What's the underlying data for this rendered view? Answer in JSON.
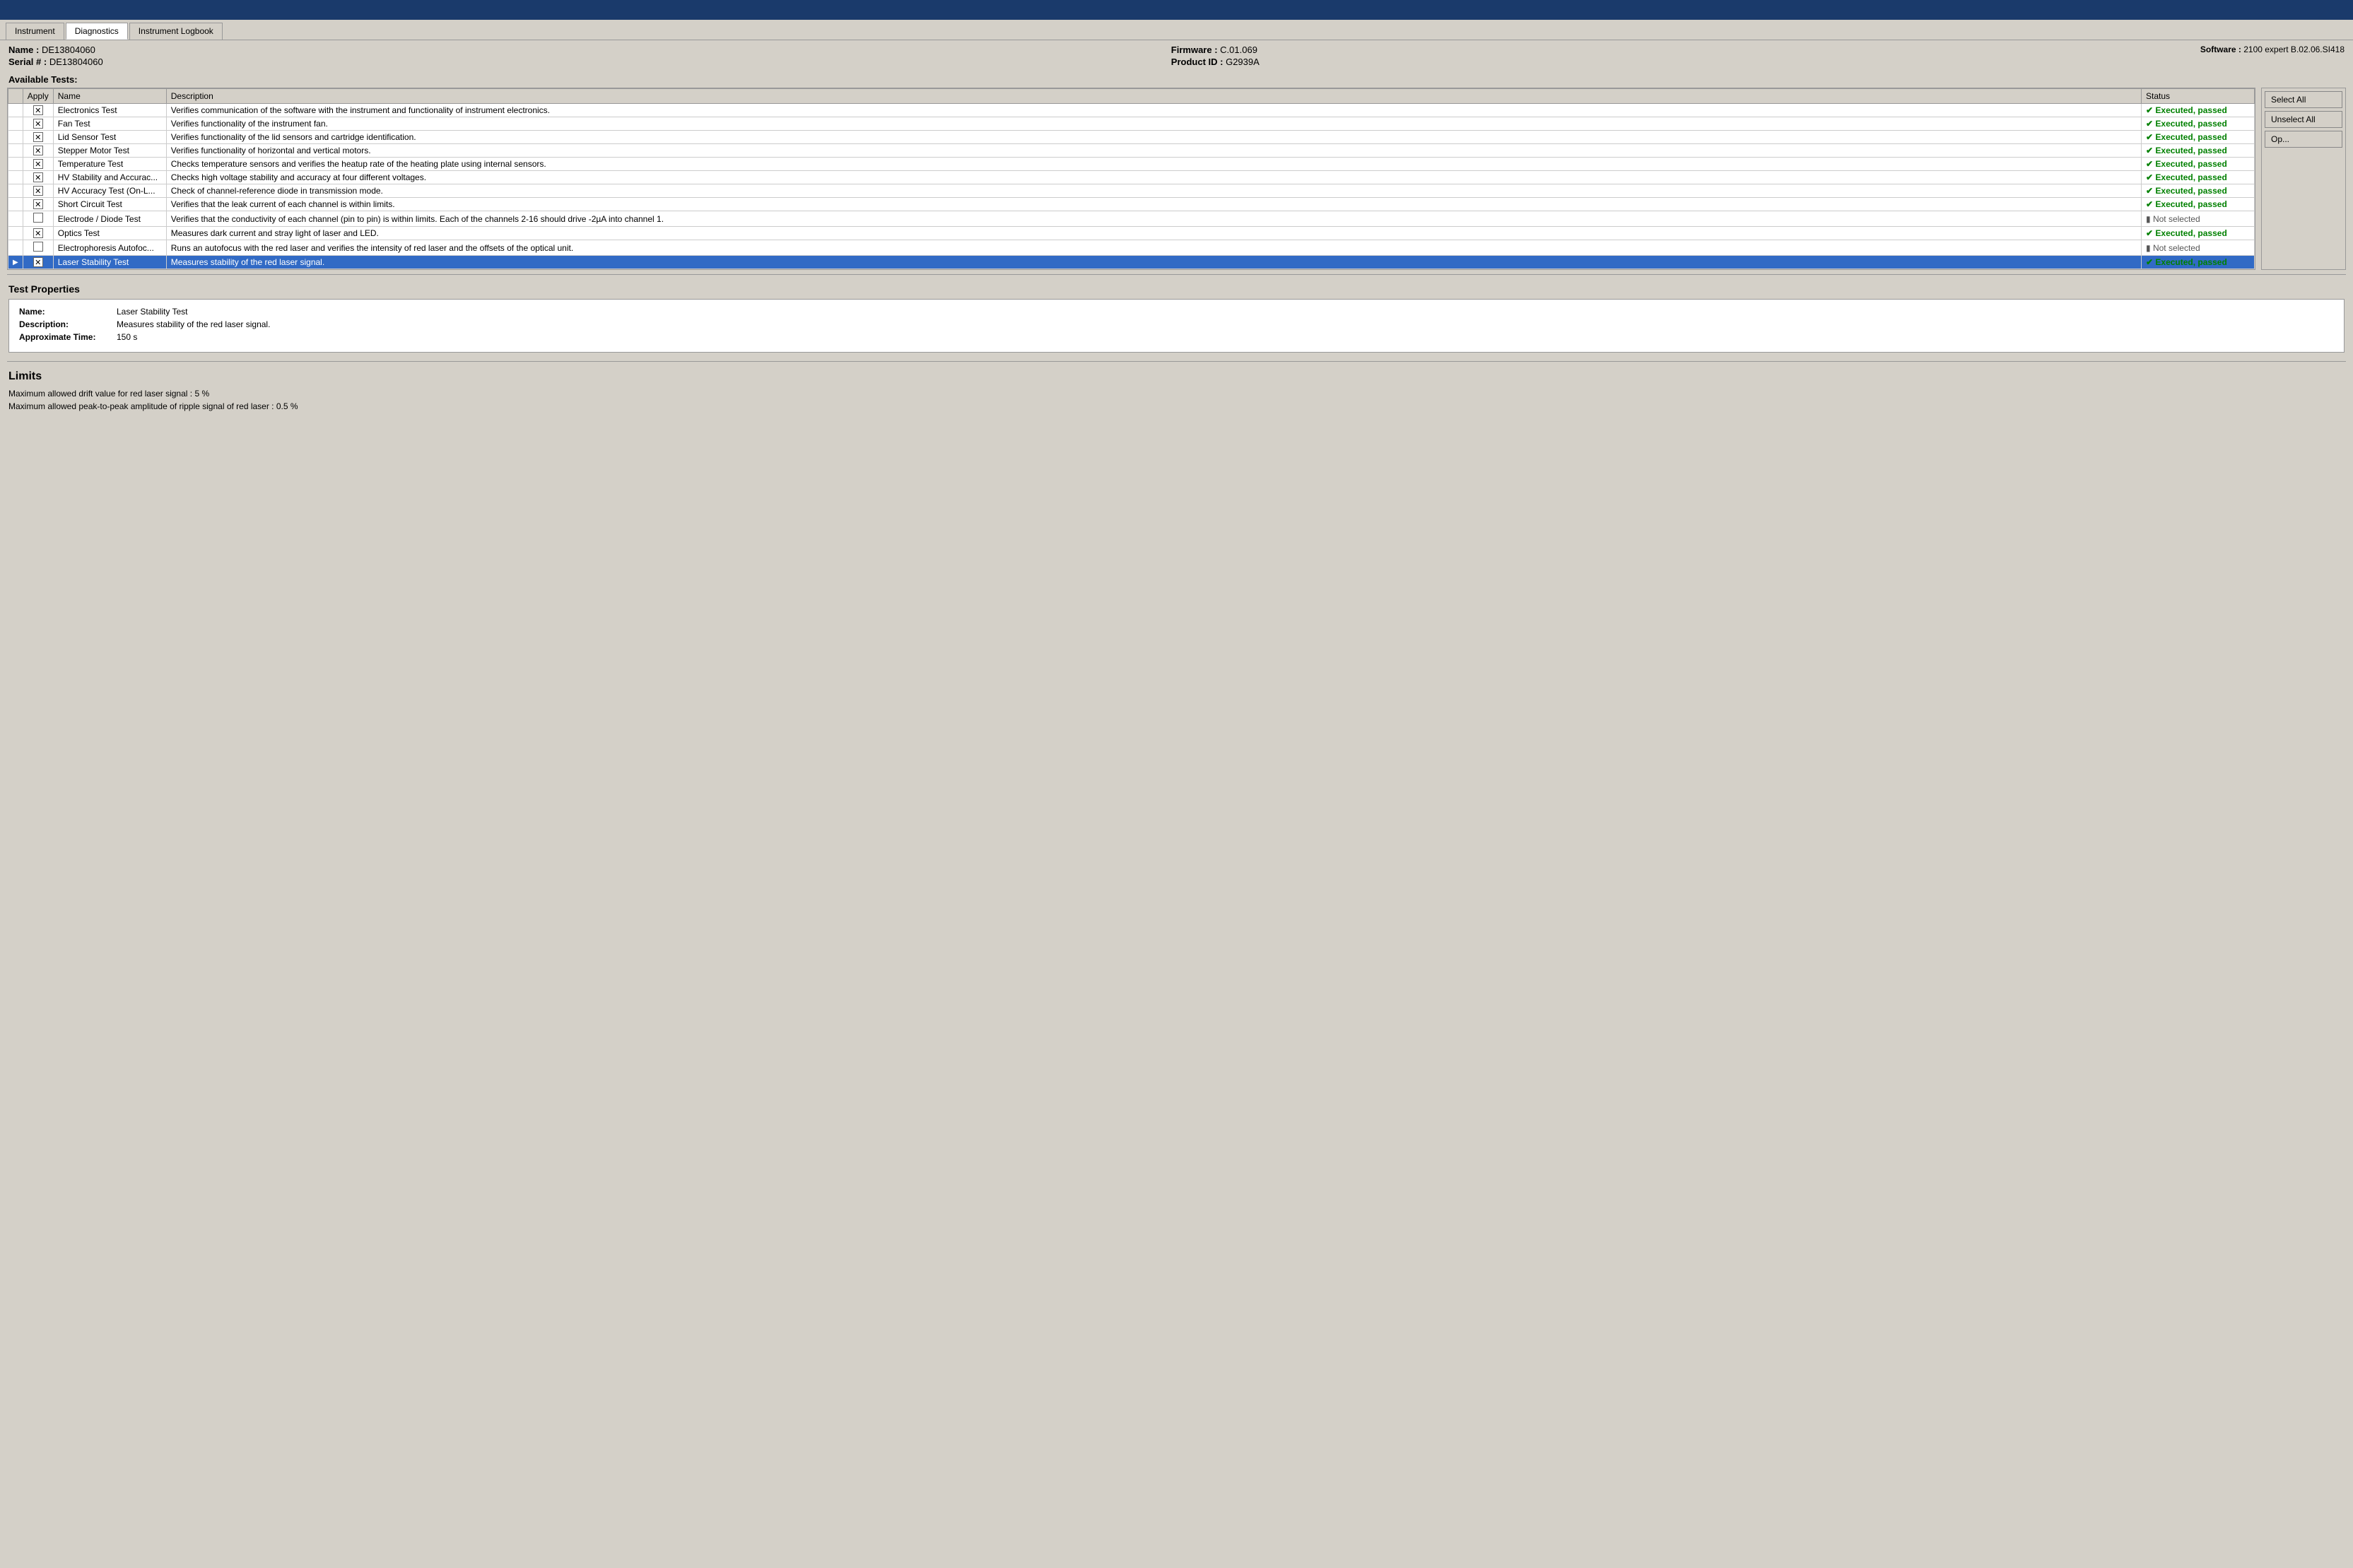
{
  "topbar": {},
  "tabs": [
    {
      "label": "Instrument",
      "active": false
    },
    {
      "label": "Diagnostics",
      "active": true
    },
    {
      "label": "Instrument Logbook",
      "active": false
    }
  ],
  "instrument_info": {
    "name_label": "Name :",
    "name_value": "DE13804060",
    "serial_label": "Serial # :",
    "serial_value": "DE13804060",
    "firmware_label": "Firmware :",
    "firmware_value": "C.01.069",
    "product_label": "Product ID :",
    "product_value": "G2939A",
    "software_label": "Software :",
    "software_value": "2100 expert B.02.06.SI418"
  },
  "available_tests_label": "Available Tests:",
  "table_headers": {
    "apply": "Apply",
    "name": "Name",
    "description": "Description",
    "status": "Status"
  },
  "tests": [
    {
      "expand": "",
      "checked": true,
      "name": "Electronics Test",
      "description": "Verifies communication of the software with the instrument and functionality of instrument electronics.",
      "status": "Executed, passed",
      "status_type": "passed"
    },
    {
      "expand": "",
      "checked": true,
      "name": "Fan Test",
      "description": "Verifies functionality of the instrument fan.",
      "status": "Executed, passed",
      "status_type": "passed"
    },
    {
      "expand": "",
      "checked": true,
      "name": "Lid Sensor Test",
      "description": "Verifies functionality of the lid sensors and cartridge identification.",
      "status": "Executed, passed",
      "status_type": "passed"
    },
    {
      "expand": "",
      "checked": true,
      "name": "Stepper Motor Test",
      "description": "Verifies functionality of horizontal and vertical motors.",
      "status": "Executed, passed",
      "status_type": "passed"
    },
    {
      "expand": "",
      "checked": true,
      "name": "Temperature Test",
      "description": "Checks temperature sensors and verifies the heatup rate of the heating plate using internal sensors.",
      "status": "Executed, passed",
      "status_type": "passed"
    },
    {
      "expand": "",
      "checked": true,
      "name": "HV Stability and Accurac...",
      "description": "Checks high voltage stability and accuracy at four different voltages.",
      "status": "Executed, passed",
      "status_type": "passed"
    },
    {
      "expand": "",
      "checked": true,
      "name": "HV Accuracy Test (On-L...",
      "description": "Check of channel-reference diode in transmission mode.",
      "status": "Executed, passed",
      "status_type": "passed"
    },
    {
      "expand": "",
      "checked": true,
      "name": "Short Circuit Test",
      "description": "Verifies that the leak current of each channel is within limits.",
      "status": "Executed, passed",
      "status_type": "passed"
    },
    {
      "expand": "",
      "checked": false,
      "name": "Electrode / Diode Test",
      "description": "Verifies that the conductivity of each  channel (pin to pin) is within limits. Each of the channels 2-16 should drive -2µA into channel 1.",
      "status": "Not selected",
      "status_type": "not_selected"
    },
    {
      "expand": "",
      "checked": true,
      "name": "Optics Test",
      "description": "Measures dark current and stray light of laser and LED.",
      "status": "Executed, passed",
      "status_type": "passed"
    },
    {
      "expand": "",
      "checked": false,
      "name": "Electrophoresis Autofoc...",
      "description": "Runs an autofocus with the red laser and verifies the intensity of red laser and the offsets of the optical unit.",
      "status": "Not selected",
      "status_type": "not_selected"
    },
    {
      "expand": "▶",
      "checked": true,
      "name": "Laser Stability Test",
      "description": "Measures stability of the red laser signal.",
      "status": "Executed, passed",
      "status_type": "passed",
      "selected": true
    }
  ],
  "sidebar_buttons": [
    {
      "label": "Select All"
    },
    {
      "label": "Unselect All"
    },
    {
      "label": "Options..."
    }
  ],
  "test_properties": {
    "title": "Test Properties",
    "name_label": "Name:",
    "name_value": "Laser Stability Test",
    "description_label": "Description:",
    "description_value": "Measures stability of the red laser signal.",
    "time_label": "Approximate Time:",
    "time_value": "150 s"
  },
  "limits": {
    "title": "Limits",
    "lines": [
      "Maximum allowed drift value for red laser signal :  5  %",
      "Maximum allowed peak-to-peak amplitude of ripple signal of red laser :  0.5  %"
    ]
  }
}
